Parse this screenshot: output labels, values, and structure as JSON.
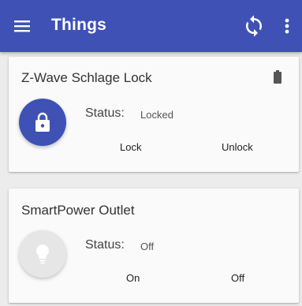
{
  "appbar": {
    "title": "Things",
    "menu_icon": "hamburger-menu-icon",
    "sync_icon": "sync-icon",
    "more_icon": "more-vert-icon",
    "color": "#3f51b5"
  },
  "things": [
    {
      "name": "Z-Wave Schlage Lock",
      "icon": "lock-icon",
      "icon_active": true,
      "status_label": "Status:",
      "status_value": "Locked",
      "actions": [
        "Lock",
        "Unlock"
      ],
      "has_battery": true,
      "battery_icon": "battery-icon"
    },
    {
      "name": "SmartPower Outlet",
      "icon": "lightbulb-icon",
      "icon_active": false,
      "status_label": "Status:",
      "status_value": "Off",
      "actions": [
        "On",
        "Off"
      ]
    }
  ]
}
